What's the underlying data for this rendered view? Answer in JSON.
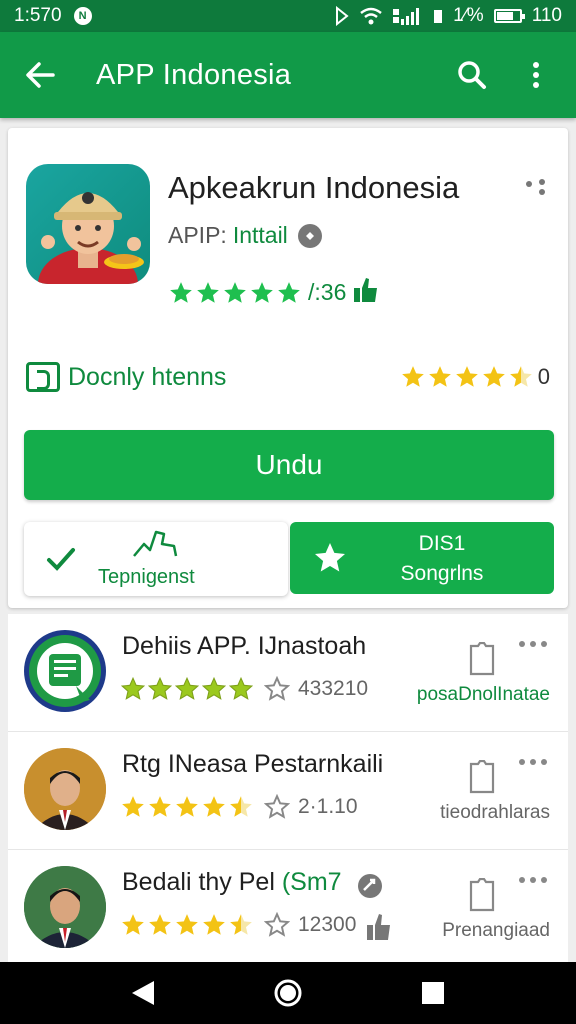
{
  "status_bar": {
    "time": "1:570",
    "notification_icon": "n-icon",
    "battery_text": "1⁄%",
    "right_text": "110",
    "battery_level": 0.75
  },
  "app_bar": {
    "title": "APP Indonesia",
    "back_icon": "arrow-left-icon",
    "search_icon": "search-icon",
    "more_icon": "more-vert-icon"
  },
  "app": {
    "name": "Apkeakrun Indonesia",
    "developer_prefix": "APIP:",
    "developer_link": "Inttail",
    "rating_stars": 5,
    "rating_count": "/:36",
    "download_label": "Docnly htenns",
    "side_rating_stars": 4.5,
    "side_rating_value": "0",
    "install_label": "Undu",
    "secondary_left_label": "Tepnigenst",
    "secondary_right_line1": "DIS1",
    "secondary_right_line2": "Songrlns"
  },
  "list": [
    {
      "title": "Dehiis APP. IJnastoah",
      "stars": 5,
      "count": "433210",
      "side_text": "posaDnolInatae",
      "side_color": "#0f8a3e"
    },
    {
      "title": "Rtg INeasa Pestarnkaili",
      "stars": 4.5,
      "count": "2·1.10",
      "side_text": "tieodrahlaras",
      "side_color": "#666666"
    },
    {
      "title_main": "Bedali thy Pel",
      "title_accent": "(Sm7",
      "stars": 4.5,
      "count": "12300",
      "side_text": "Prenangiaad",
      "side_color": "#666666"
    }
  ],
  "colors": {
    "primary": "#119a48",
    "primary_dark": "#0e7a3c",
    "button_green": "#14ad4b",
    "star_green": "#1fbf4f",
    "star_yellow": "#f3c315"
  }
}
